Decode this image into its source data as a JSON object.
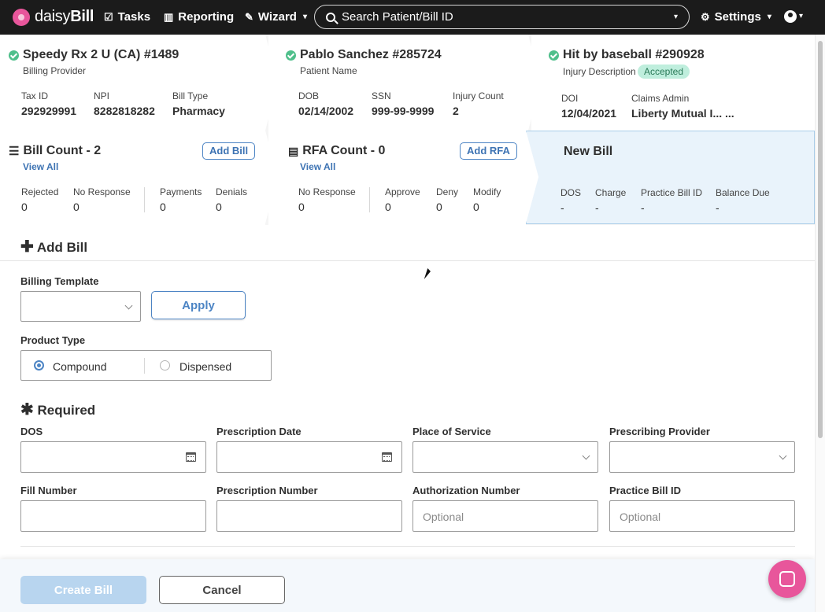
{
  "nav": {
    "logo_part1": "daisy",
    "logo_part2": "Bill",
    "tasks": "Tasks",
    "reporting": "Reporting",
    "wizard": "Wizard",
    "search_placeholder": "Search Patient/Bill ID",
    "settings": "Settings"
  },
  "provider": {
    "title": "Speedy Rx 2 U (CA) #1489",
    "subtitle": "Billing Provider",
    "tax_id_label": "Tax ID",
    "tax_id": "292929991",
    "npi_label": "NPI",
    "npi": "8282818282",
    "bill_type_label": "Bill Type",
    "bill_type": "Pharmacy"
  },
  "patient": {
    "title": "Pablo Sanchez #285724",
    "subtitle": "Patient Name",
    "dob_label": "DOB",
    "dob": "02/14/2002",
    "ssn_label": "SSN",
    "ssn": "999-99-9999",
    "injury_count_label": "Injury Count",
    "injury_count": "2"
  },
  "injury": {
    "title": "Hit by baseball #290928",
    "subtitle": "Injury Description",
    "status": "Accepted",
    "doi_label": "DOI",
    "doi": "12/04/2021",
    "claims_admin_label": "Claims Admin",
    "claims_admin": "Liberty Mutual I... ..."
  },
  "bills": {
    "title": "Bill Count - 2",
    "add_label": "Add Bill",
    "view_all": "View All",
    "rejected_label": "Rejected",
    "rejected": "0",
    "no_response_label": "No Response",
    "no_response": "0",
    "payments_label": "Payments",
    "payments": "0",
    "denials_label": "Denials",
    "denials": "0"
  },
  "rfa": {
    "title": "RFA Count - 0",
    "add_label": "Add RFA",
    "view_all": "View All",
    "no_response_label": "No Response",
    "no_response": "0",
    "approve_label": "Approve",
    "approve": "0",
    "deny_label": "Deny",
    "deny": "0",
    "modify_label": "Modify",
    "modify": "0"
  },
  "new_bill": {
    "title": "New Bill",
    "dos_label": "DOS",
    "dos": "-",
    "charge_label": "Charge",
    "charge": "-",
    "practice_bill_id_label": "Practice Bill ID",
    "practice_bill_id": "-",
    "balance_due_label": "Balance Due",
    "balance_due": "-"
  },
  "form": {
    "section_title": "Add Bill",
    "billing_template_label": "Billing Template",
    "apply_label": "Apply",
    "product_type_label": "Product Type",
    "product_options": [
      "Compound",
      "Dispensed"
    ],
    "product_selected": "Compound",
    "required_title": "Required",
    "dos_label": "DOS",
    "prescription_date_label": "Prescription Date",
    "place_of_service_label": "Place of Service",
    "prescribing_provider_label": "Prescribing Provider",
    "fill_number_label": "Fill Number",
    "prescription_number_label": "Prescription Number",
    "authorization_number_label": "Authorization Number",
    "practice_bill_id_label": "Practice Bill ID",
    "optional_placeholder": "Optional"
  },
  "footer": {
    "create_label": "Create Bill",
    "cancel_label": "Cancel"
  },
  "colors": {
    "accent": "#4c84c4",
    "brand_pink": "#e8569b",
    "success": "#4fbf8b",
    "nav_bg": "#1b1b1b"
  }
}
